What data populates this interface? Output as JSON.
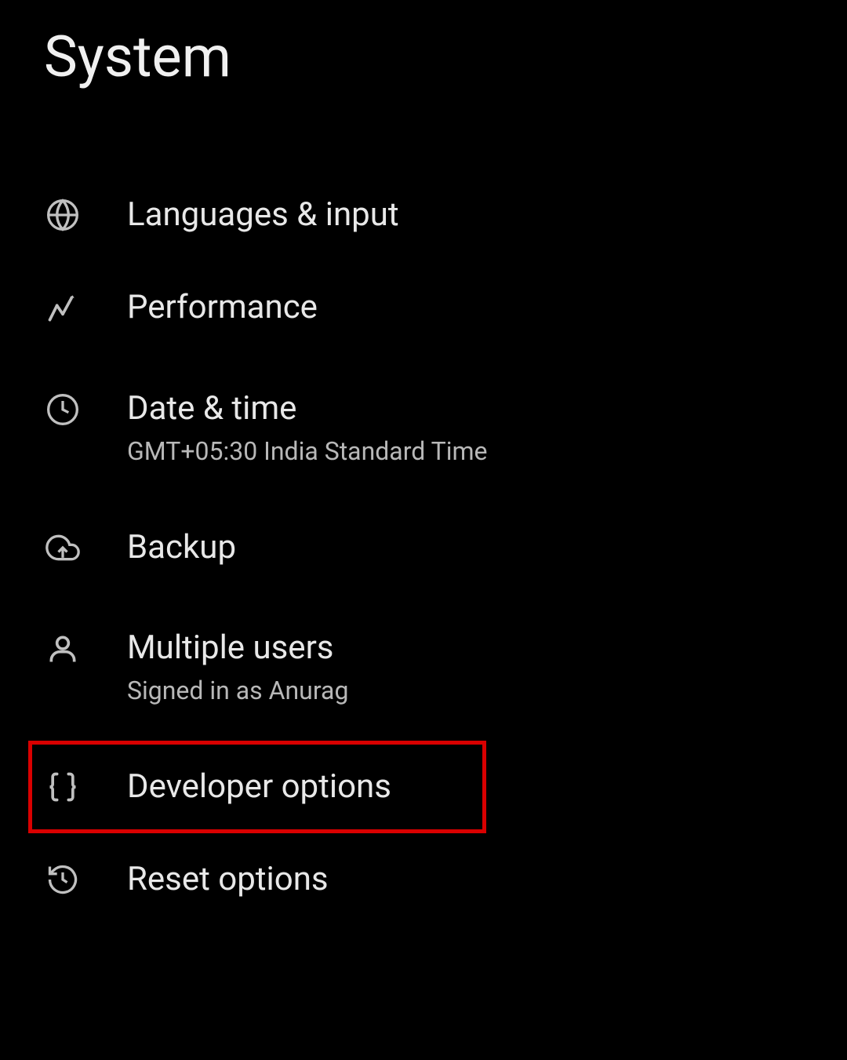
{
  "page": {
    "title": "System"
  },
  "menu": {
    "items": [
      {
        "label": "Languages & input",
        "subtitle": null,
        "icon": "globe-icon"
      },
      {
        "label": "Performance",
        "subtitle": null,
        "icon": "performance-icon"
      },
      {
        "label": "Date & time",
        "subtitle": "GMT+05:30 India Standard Time",
        "icon": "clock-icon"
      },
      {
        "label": "Backup",
        "subtitle": null,
        "icon": "cloud-upload-icon"
      },
      {
        "label": "Multiple users",
        "subtitle": "Signed in as Anurag",
        "icon": "user-icon"
      },
      {
        "label": "Developer options",
        "subtitle": null,
        "icon": "braces-icon",
        "highlighted": true
      },
      {
        "label": "Reset options",
        "subtitle": null,
        "icon": "reset-icon"
      }
    ]
  }
}
